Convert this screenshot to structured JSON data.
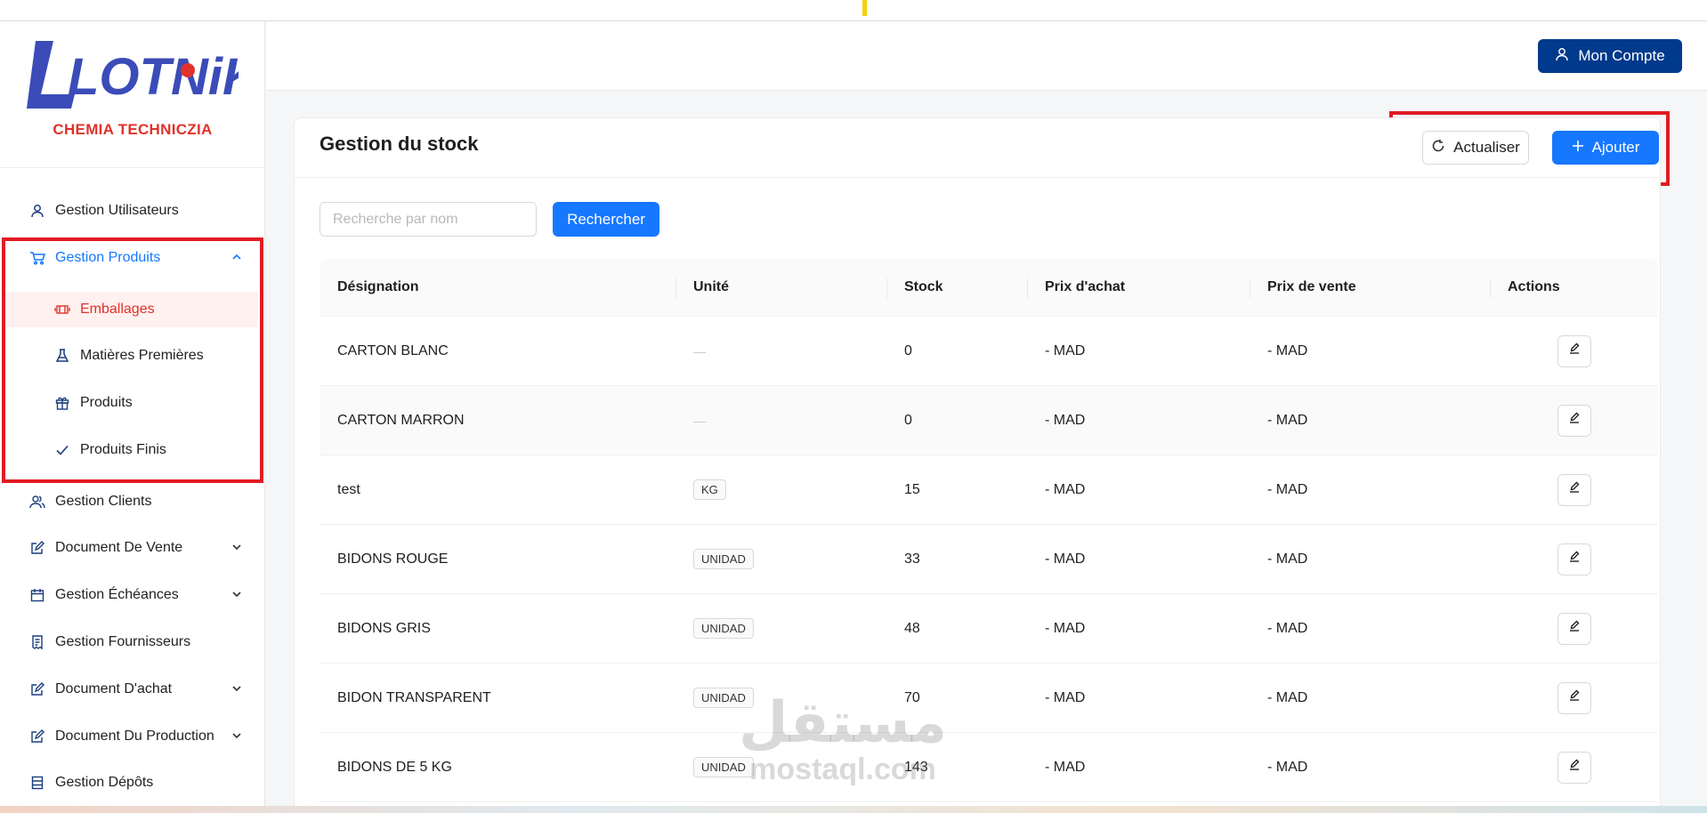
{
  "brand": {
    "logo_text": "LOTNiK",
    "subtitle": "CHEMIA TECHNICZIA"
  },
  "colors": {
    "primary": "#1677ff",
    "account": "#003a8c",
    "brand_blue": "#3b4cb8",
    "brand_red": "#e0322a",
    "highlight": "#e21b23"
  },
  "sidebar": {
    "items": [
      {
        "label": "Gestion Utilisateurs",
        "icon": "user-icon"
      },
      {
        "label": "Gestion Produits",
        "icon": "cart-icon"
      },
      {
        "label": "Emballages",
        "icon": "package-icon"
      },
      {
        "label": "Matières Premières",
        "icon": "flask-icon"
      },
      {
        "label": "Produits",
        "icon": "gift-icon"
      },
      {
        "label": "Produits Finis",
        "icon": "check-icon"
      },
      {
        "label": "Gestion Clients",
        "icon": "users-icon"
      },
      {
        "label": "Document De Vente",
        "icon": "edit-doc-icon"
      },
      {
        "label": "Gestion Échéances",
        "icon": "calendar-icon"
      },
      {
        "label": "Gestion Fournisseurs",
        "icon": "invoice-icon"
      },
      {
        "label": "Document D'achat",
        "icon": "edit-doc-icon"
      },
      {
        "label": "Document Du Production",
        "icon": "edit-doc-icon"
      },
      {
        "label": "Gestion Dépôts",
        "icon": "database-icon"
      }
    ]
  },
  "header": {
    "account_label": "Mon Compte"
  },
  "page": {
    "title": "Gestion du stock",
    "refresh_label": "Actualiser",
    "add_label": "Ajouter",
    "search_placeholder": "Recherche par nom",
    "search_button": "Rechercher"
  },
  "table": {
    "columns": [
      "Désignation",
      "Unité",
      "Stock",
      "Prix d'achat",
      "Prix de vente",
      "Actions"
    ],
    "rows": [
      {
        "designation": "CARTON BLANC",
        "unite": "—",
        "stock": "0",
        "prix_achat": "- MAD",
        "prix_vente": "- MAD"
      },
      {
        "designation": "CARTON MARRON",
        "unite": "—",
        "stock": "0",
        "prix_achat": "- MAD",
        "prix_vente": "- MAD"
      },
      {
        "designation": "test",
        "unite": "KG",
        "stock": "15",
        "prix_achat": "- MAD",
        "prix_vente": "- MAD"
      },
      {
        "designation": "BIDONS ROUGE",
        "unite": "UNIDAD",
        "stock": "33",
        "prix_achat": "- MAD",
        "prix_vente": "- MAD"
      },
      {
        "designation": "BIDONS GRIS",
        "unite": "UNIDAD",
        "stock": "48",
        "prix_achat": "- MAD",
        "prix_vente": "- MAD"
      },
      {
        "designation": "BIDON TRANSPARENT",
        "unite": "UNIDAD",
        "stock": "70",
        "prix_achat": "- MAD",
        "prix_vente": "- MAD"
      },
      {
        "designation": "BIDONS DE 5 KG",
        "unite": "UNIDAD",
        "stock": "143",
        "prix_achat": "- MAD",
        "prix_vente": "- MAD"
      }
    ]
  },
  "watermark": {
    "arabic": "مستقل",
    "latin": "mostaql.com"
  }
}
